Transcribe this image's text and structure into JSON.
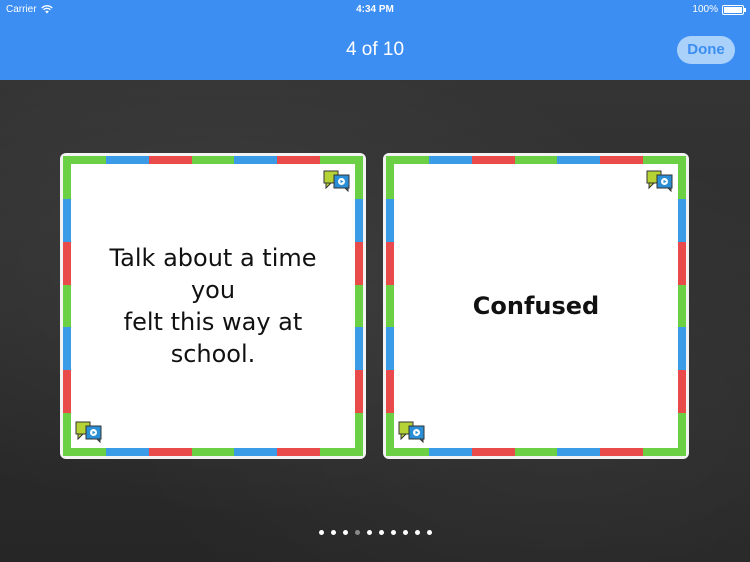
{
  "status_bar": {
    "carrier": "Carrier",
    "time": "4:34 PM",
    "battery": "100%"
  },
  "nav": {
    "title": "4 of 10",
    "done_label": "Done"
  },
  "cards": [
    {
      "text_line1": "Talk about a time you",
      "text_line2": "felt this way at school."
    },
    {
      "text": "Confused"
    }
  ],
  "pager": {
    "total": 10,
    "current": 4
  },
  "colors": {
    "accent": "#3c8ef2",
    "green": "#6cd044",
    "blue": "#3a9be6",
    "red": "#e94b4b"
  },
  "icons": [
    "wifi-icon",
    "battery-icon",
    "speech-bubble-icon"
  ]
}
